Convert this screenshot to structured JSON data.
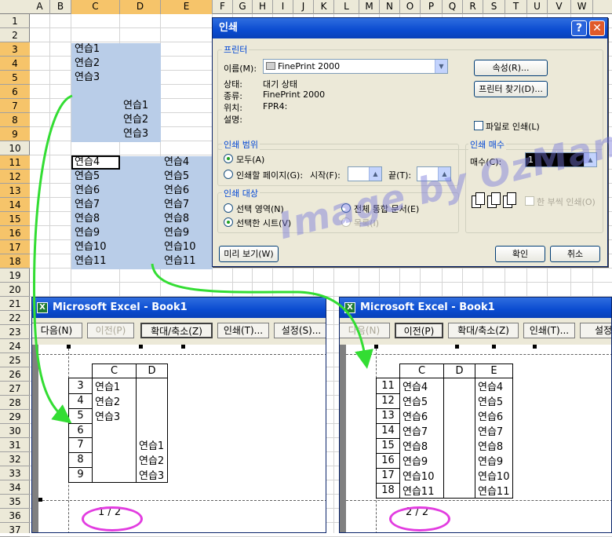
{
  "sheet": {
    "columns": [
      "A",
      "B",
      "C",
      "D",
      "E",
      "F",
      "G",
      "H",
      "I",
      "J",
      "K",
      "L",
      "M",
      "N",
      "O",
      "P",
      "Q",
      "R",
      "S",
      "T",
      "U",
      "V",
      "W"
    ],
    "rows": [
      "1",
      "2",
      "3",
      "4",
      "5",
      "6",
      "7",
      "8",
      "9",
      "10",
      "11",
      "12",
      "13",
      "14",
      "15",
      "16",
      "17",
      "18",
      "19",
      "20",
      "21",
      "22",
      "23",
      "24",
      "25",
      "26",
      "27",
      "28",
      "29",
      "30",
      "31",
      "32",
      "33",
      "34",
      "35",
      "36",
      "37"
    ],
    "cells": {
      "c3": "연습1",
      "c4": "연습2",
      "c5": "연습3",
      "d7": "연습1",
      "d8": "연습2",
      "d9": "연습3",
      "c11": "연습4",
      "c12": "연습5",
      "c13": "연습6",
      "c14": "연습7",
      "c15": "연습8",
      "c16": "연습9",
      "c17": "연습10",
      "c18": "연습11",
      "e11": "연습4",
      "e12": "연습5",
      "e13": "연습6",
      "e14": "연습7",
      "e15": "연습8",
      "e16": "연습9",
      "e17": "연습10",
      "e18": "연습11"
    }
  },
  "dialog": {
    "title": "인쇄",
    "help": "?",
    "close": "✕",
    "printer_group": "프린터",
    "name_label": "이름(M):",
    "printer_name": "FinePrint 2000",
    "status_label": "상태:",
    "status_value": "대기 상태",
    "type_label": "종류:",
    "type_value": "FinePrint 2000",
    "where_label": "위치:",
    "where_value": "FPR4:",
    "comment_label": "설명:",
    "properties_btn": "속성(R)...",
    "find_printer_btn": "프린터 찾기(D)...",
    "print_to_file": "파일로 인쇄(L)",
    "range_group": "인쇄 범위",
    "range_all": "모두(A)",
    "range_pages": "인쇄할 페이지(G):",
    "from_label": "시작(F):",
    "to_label": "끝(T):",
    "what_group": "인쇄 대상",
    "what_selection": "선택 영역(N)",
    "what_workbook": "전체 통합 문서(E)",
    "what_sheets": "선택한 시트(V)",
    "what_list": "목록(I)",
    "copies_group": "인쇄 매수",
    "copies_label": "매수(C):",
    "copies_value": "1",
    "collate": "한 부씩 인쇄(O)",
    "preview_btn": "미리 보기(W)",
    "ok_btn": "확인",
    "cancel_btn": "취소"
  },
  "watermark": "Image by OzMan",
  "preview1": {
    "title": "Microsoft Excel - Book1",
    "buttons": [
      "다음(N)",
      "이전(P)",
      "확대/축소(Z)",
      "인쇄(T)...",
      "설정(S)..."
    ],
    "col_headers": [
      "C",
      "D"
    ],
    "rows": [
      {
        "n": "3",
        "c": "연습1",
        "d": ""
      },
      {
        "n": "4",
        "c": "연습2",
        "d": ""
      },
      {
        "n": "5",
        "c": "연습3",
        "d": ""
      },
      {
        "n": "6",
        "c": "",
        "d": ""
      },
      {
        "n": "7",
        "c": "",
        "d": "연습1"
      },
      {
        "n": "8",
        "c": "",
        "d": "연습2"
      },
      {
        "n": "9",
        "c": "",
        "d": "연습3"
      }
    ],
    "page": "1 / 2"
  },
  "preview2": {
    "title": "Microsoft Excel - Book1",
    "buttons": [
      "다음(N)",
      "이전(P)",
      "확대/축소(Z)",
      "인쇄(T)...",
      "설정"
    ],
    "col_headers": [
      "C",
      "D",
      "E"
    ],
    "rows": [
      {
        "n": "11",
        "c": "연습4",
        "d": "",
        "e": "연습4"
      },
      {
        "n": "12",
        "c": "연습5",
        "d": "",
        "e": "연습5"
      },
      {
        "n": "13",
        "c": "연습6",
        "d": "",
        "e": "연습6"
      },
      {
        "n": "14",
        "c": "연습7",
        "d": "",
        "e": "연습7"
      },
      {
        "n": "15",
        "c": "연습8",
        "d": "",
        "e": "연습8"
      },
      {
        "n": "16",
        "c": "연습9",
        "d": "",
        "e": "연습9"
      },
      {
        "n": "17",
        "c": "연습10",
        "d": "",
        "e": "연습10"
      },
      {
        "n": "18",
        "c": "연습11",
        "d": "",
        "e": "연습11"
      }
    ],
    "page": "2 / 2"
  },
  "colors": {
    "selection": "#b9cde8",
    "title_bar": "#0a4bd0",
    "arrow": "#33dd33",
    "circle": "#e23ce0",
    "watermark": "#7878dc"
  }
}
